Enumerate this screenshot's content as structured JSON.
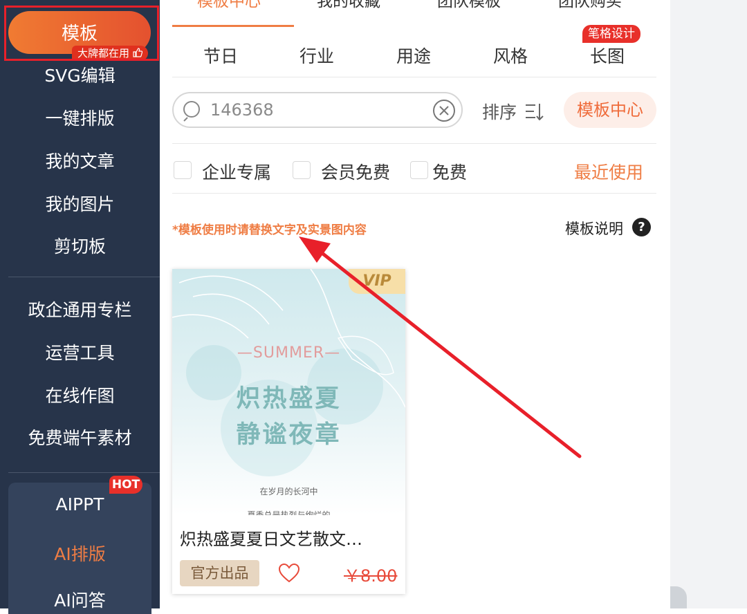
{
  "sidebar": {
    "active_item": "模板",
    "active_badge": "大牌都在用",
    "items": [
      "SVG编辑",
      "一键排版",
      "我的文章",
      "我的图片",
      "剪切板"
    ],
    "group2": [
      "政企通用专栏",
      "运营工具",
      "在线作图",
      "免费端午素材"
    ],
    "ai_items": [
      "AIPPT",
      "AI排版",
      "AI问答"
    ],
    "hot_badge": "HOT",
    "colors": {
      "background": "#27344a",
      "accent": "#ef7d44",
      "ai_active": "#ef7d44"
    }
  },
  "top_tabs": [
    "模板中心",
    "我的收藏",
    "团队模板",
    "团队购买"
  ],
  "categories": [
    "节日",
    "行业",
    "用途",
    "风格",
    "长图"
  ],
  "category_badge": "笔格设计",
  "search": {
    "value": "146368"
  },
  "sort_label": "排序",
  "template_center_button": "模板中心",
  "filters": [
    "企业专属",
    "会员免费",
    "免费"
  ],
  "recent_label": "最近使用",
  "notice": "*模板使用时请替换文字及实景图内容",
  "template_help": "模板说明",
  "card": {
    "vip": "VIP",
    "preview": {
      "summer": "—SUMMER—",
      "line1": "炽热盛夏",
      "line2": "静谧夜章",
      "small1": "在岁月的长河中",
      "small2": "夏季总是热烈与绚烂的"
    },
    "title": "炽热盛夏夏日文艺散文…",
    "official_label": "官方出品",
    "price": "￥8.00"
  }
}
